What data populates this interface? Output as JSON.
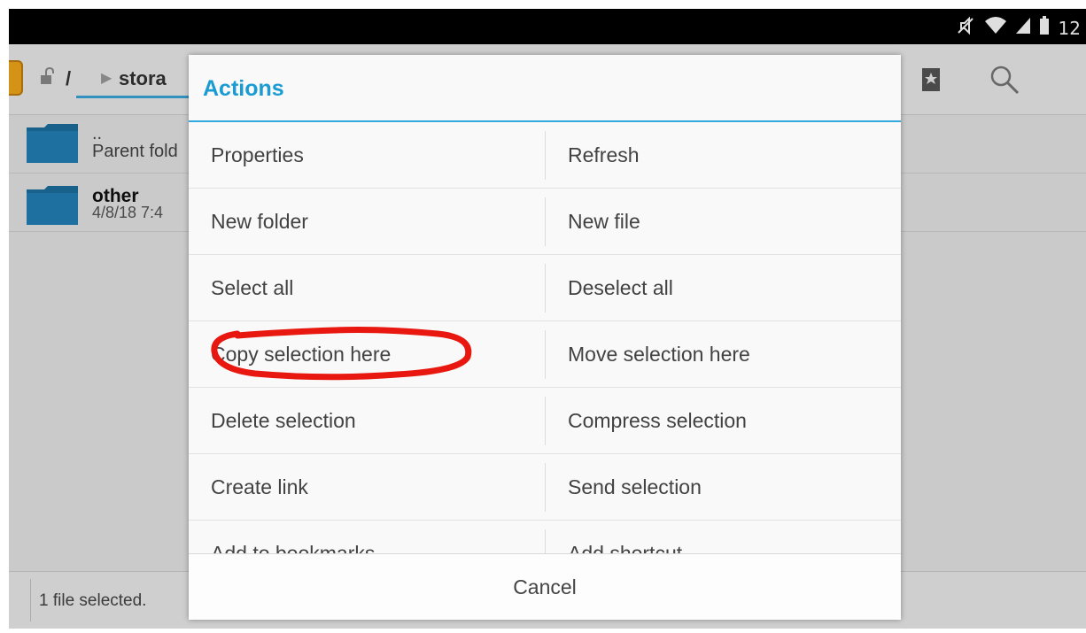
{
  "status_bar": {
    "time": "12",
    "icons": [
      "mute-icon",
      "wifi-icon",
      "signal-icon",
      "battery-icon"
    ]
  },
  "toolbar": {
    "root_label": "/",
    "path_label": "stora",
    "icons": [
      "lock-icon",
      "bookmark-icon",
      "search-icon"
    ]
  },
  "file_list": {
    "items": [
      {
        "name": "..",
        "subtitle": "Parent fold"
      },
      {
        "name": "other",
        "date": "4/8/18 7:4"
      }
    ]
  },
  "bottom_bar": {
    "status": "1 file selected."
  },
  "dialog": {
    "title": "Actions",
    "rows": [
      {
        "left": "Properties",
        "right": "Refresh"
      },
      {
        "left": "New folder",
        "right": "New file"
      },
      {
        "left": "Select all",
        "right": "Deselect all"
      },
      {
        "left": "Copy selection here",
        "right": "Move selection here"
      },
      {
        "left": "Delete selection",
        "right": "Compress selection"
      },
      {
        "left": "Create link",
        "right": "Send selection"
      },
      {
        "left": "Add to bookmarks",
        "right": "Add shortcut"
      }
    ],
    "cancel_label": "Cancel"
  },
  "annotation": {
    "color": "#e8170f",
    "target": "Copy selection here"
  },
  "colors": {
    "accent": "#1a9bd2",
    "folder": "#1c6f9e",
    "status_bar": "#000000"
  }
}
